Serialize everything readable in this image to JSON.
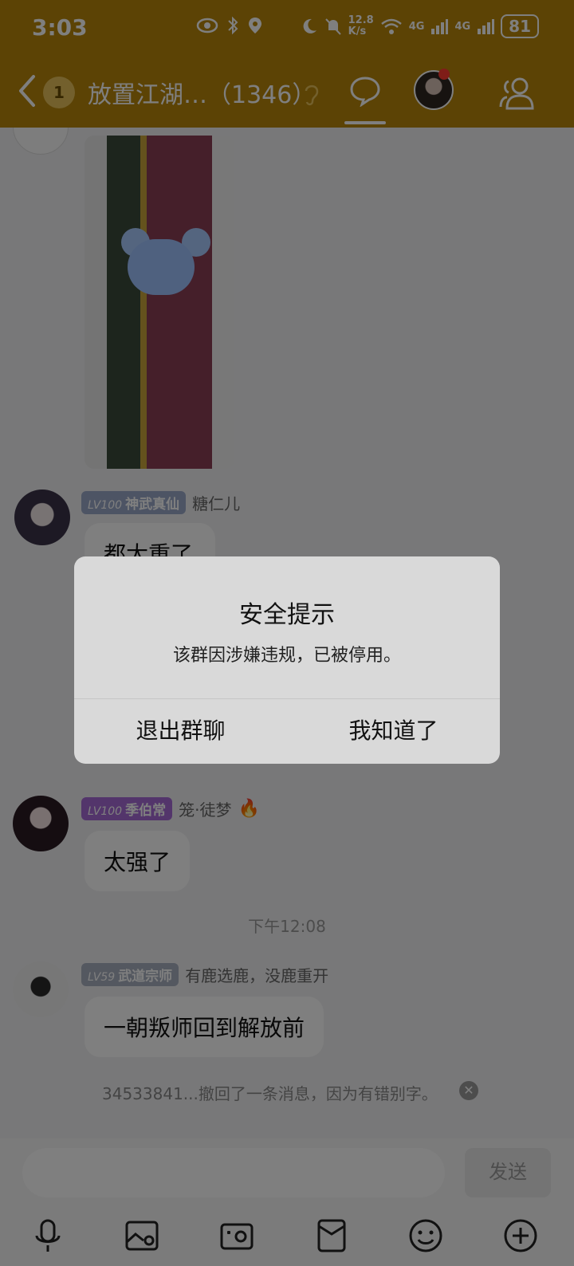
{
  "status_bar": {
    "time": "3:03",
    "net_speed_value": "12.8",
    "net_speed_unit": "K/s",
    "signal_label_1": "4G",
    "signal_label_2": "4G",
    "battery": "81"
  },
  "header": {
    "unread_count": "1",
    "group_title": "放置江湖…（1346）",
    "accent_color": "#b8860b"
  },
  "messages": [
    {
      "level": "LV100",
      "title": "神武真仙",
      "sender": "糖仁儿",
      "text": "都太重了"
    },
    {
      "level": "LV100",
      "title": "季伯常",
      "sender": "笼·徒梦",
      "text": "太强了"
    },
    {
      "level": "LV59",
      "title": "武道宗师",
      "sender": "有鹿选鹿，没鹿重开",
      "text": "一朝叛师回到解放前"
    }
  ],
  "timestamp": "下午12:08",
  "recall_notice": "34533841...撤回了一条消息，因为有错别字。",
  "composer": {
    "placeholder": "",
    "send_label": "发送"
  },
  "dialog": {
    "title": "安全提示",
    "message": "该群因涉嫌违规，已被停用。",
    "exit_label": "退出群聊",
    "ok_label": "我知道了"
  },
  "icons": [
    "chevron-left-icon",
    "ear-icon",
    "chat-bubble-icon",
    "members-icon",
    "mic-icon",
    "image-icon",
    "camera-icon",
    "red-packet-icon",
    "emoji-icon",
    "plus-icon"
  ]
}
